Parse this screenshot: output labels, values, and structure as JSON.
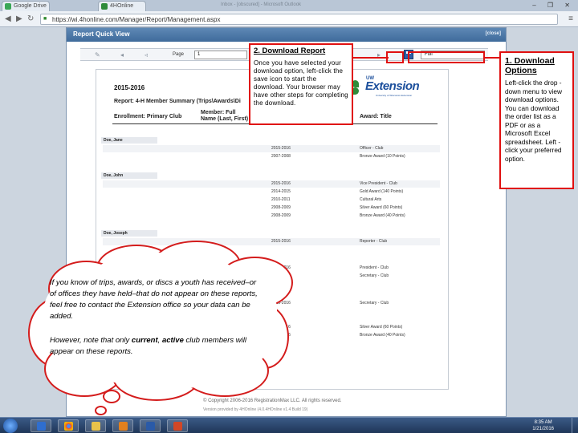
{
  "browser": {
    "tabs": [
      {
        "label": "Google Drive",
        "color": "#3aa757"
      },
      {
        "label": "4HOnline",
        "color": "#2e8b3a"
      }
    ],
    "window_title": "Inbox - [obscured] - Microsoft Outlook",
    "window_controls": "– ❐ ✕",
    "url": "https://wi.4honline.com/Manager/Report/Management.aspx"
  },
  "panel": {
    "title": "Report Quick View",
    "close_label": "[close]",
    "toolbar": {
      "page_label": "Page",
      "page_value": "1",
      "format_value": "Full"
    }
  },
  "report": {
    "year": "2015-2016",
    "title": "Report: 4-H Member Summary (Trips\\Awards\\Di",
    "columns": [
      "Enrollment: Primary Club",
      "Member: Full Name (Last, First)",
      "Award: Title"
    ],
    "logo": {
      "uw": "UW",
      "extension": "Extension",
      "sub": "University of Wisconsin-Extension"
    },
    "members": [
      {
        "name": "Doe, Jane",
        "rows": [
          {
            "year": "2015-2016",
            "award": "Officer - Club"
          },
          {
            "year": "2007-2008",
            "award": "Bronze Award (10 Points)"
          }
        ]
      },
      {
        "name": "Doe, John",
        "rows": [
          {
            "year": "2015-2016",
            "award": "Vice President - Club"
          },
          {
            "year": "2014-2015",
            "award": "Gold Award (140 Points)"
          },
          {
            "year": "2010-2011",
            "award": "Cultural Arts"
          },
          {
            "year": "2008-2009",
            "award": "Silver Award (60 Points)"
          },
          {
            "year": "2008-2009",
            "award": "Bronze Award (40 Points)"
          }
        ]
      },
      {
        "name": "Doe, Joseph",
        "rows": [
          {
            "year": "2015-2016",
            "award": "Reporter - Club"
          },
          {
            "year": "2015-2016",
            "award": "President - Club"
          },
          {
            "year": "2015-2016",
            "award": "Secretary - Club"
          },
          {
            "year": "2015-2016",
            "award": "Secretary - Club"
          },
          {
            "year": "2015-2016",
            "award": "Silver Award (60 Points)"
          },
          {
            "year": "2015-2016",
            "award": "Bronze Award (40 Points)"
          }
        ]
      }
    ],
    "footer": "© Copyright 2006-2016 RegistrationMax LLC. All rights reserved.",
    "footer2": "Version provided by 4HOnline (4.0.4HOnline v1.4 Build 19)"
  },
  "callouts": {
    "download_report": {
      "title": "2. Download Report",
      "body": "Once you have selected your download option, left-click the save icon to start the download. Your browser may have other steps for completing the download."
    },
    "download_options": {
      "title": "1. Download Options",
      "body": "Left-click the drop -down menu to view download options. You can download the order list as a PDF or as a Microsoft Excel spreadsheet. Left -click your preferred option."
    }
  },
  "cloud": {
    "text1": "If you know of trips, awards, or discs a youth has received–or of offices they have held–that do not appear on these reports, feel free to contact the Extension office so your data can be added.",
    "text2_pre": "However, note that only ",
    "text2_current": "current",
    "text2_mid": ", ",
    "text2_active": "active",
    "text2_post": " club members will appear on these reports."
  },
  "taskbar": {
    "time": "8:35 AM",
    "date": "1/21/2016"
  },
  "colors": {
    "callout_border": "#e01010",
    "cloud_border": "#d41c1c",
    "panel_header": "#4a77a8"
  }
}
